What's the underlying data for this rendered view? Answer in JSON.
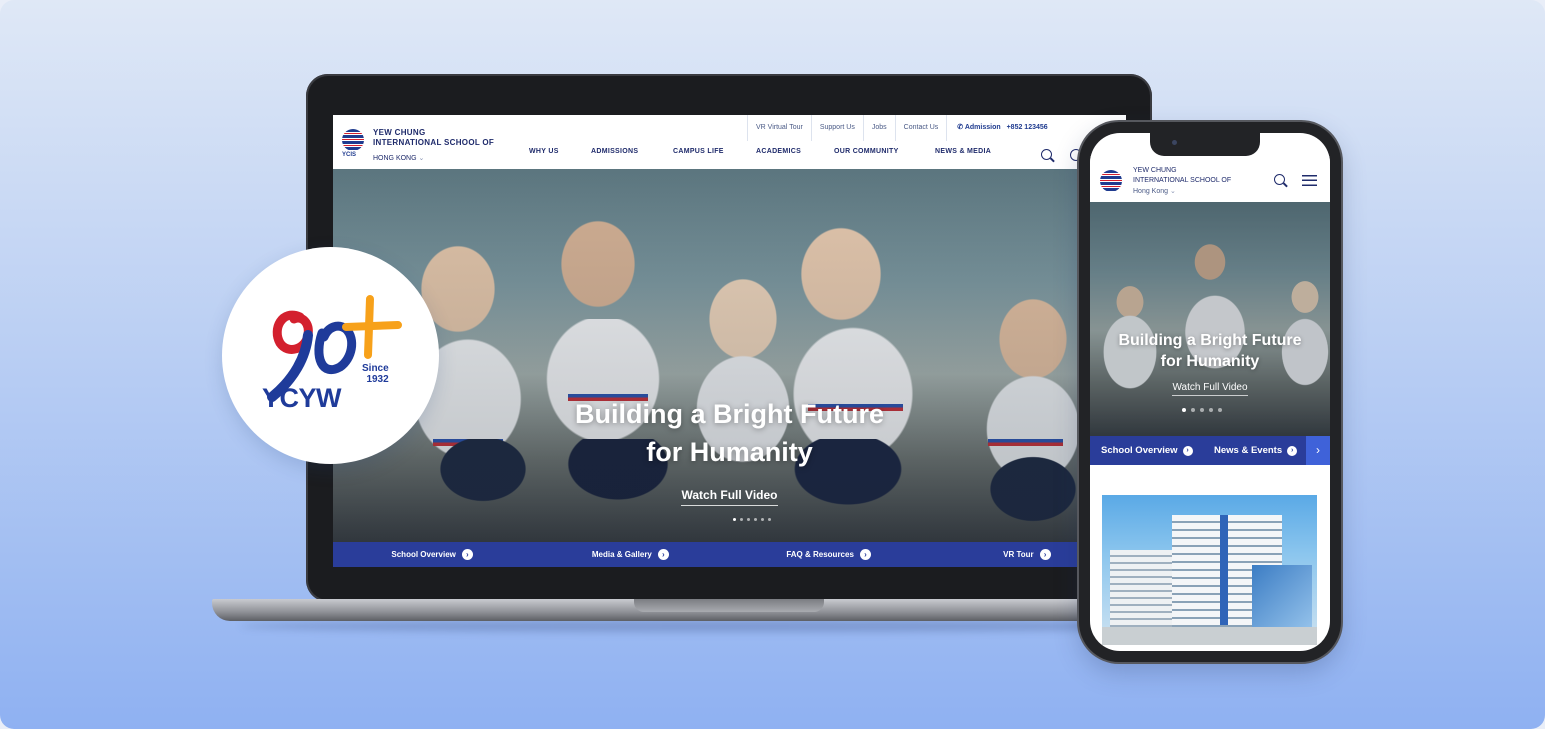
{
  "colors": {
    "brand_navy": "#1f2b6b",
    "brand_blue_bar": "#2a3d9a",
    "brand_red": "#d3202e",
    "badge_orange": "#f7a11a",
    "badge_blue": "#1f3b9a"
  },
  "badge": {
    "since_line1": "Since",
    "since_line2": "1932",
    "wordmark": "YCYW"
  },
  "desktop": {
    "logo_caption": "YCIS",
    "brand_line1": "YEW CHUNG",
    "brand_line2": "INTERNATIONAL SCHOOL OF",
    "campus": "HONG KONG",
    "utility_links": [
      "VR Virtual Tour",
      "Support Us",
      "Jobs",
      "Contact Us"
    ],
    "admission_label": "Admission",
    "admission_phone": "+852 123456",
    "nav": [
      "WHY US",
      "ADMISSIONS",
      "CAMPUS LIFE",
      "ACADEMICS",
      "OUR COMMUNITY",
      "NEWS & MEDIA"
    ],
    "hero_title_line1": "Building a Bright Future",
    "hero_title_line2": "for Humanity",
    "hero_cta": "Watch Full Video",
    "quick_links": [
      "School Overview",
      "Media & Gallery",
      "FAQ & Resources",
      "VR Tour"
    ]
  },
  "mobile": {
    "brand_line1": "YEW CHUNG",
    "brand_line2": "INTERNATIONAL SCHOOL OF",
    "campus": "Hong Kong",
    "hero_title_line1": "Building a Bright Future",
    "hero_title_line2": "for Humanity",
    "hero_cta": "Watch Full Video",
    "quick_links": [
      "School Overview",
      "News & Events"
    ]
  }
}
